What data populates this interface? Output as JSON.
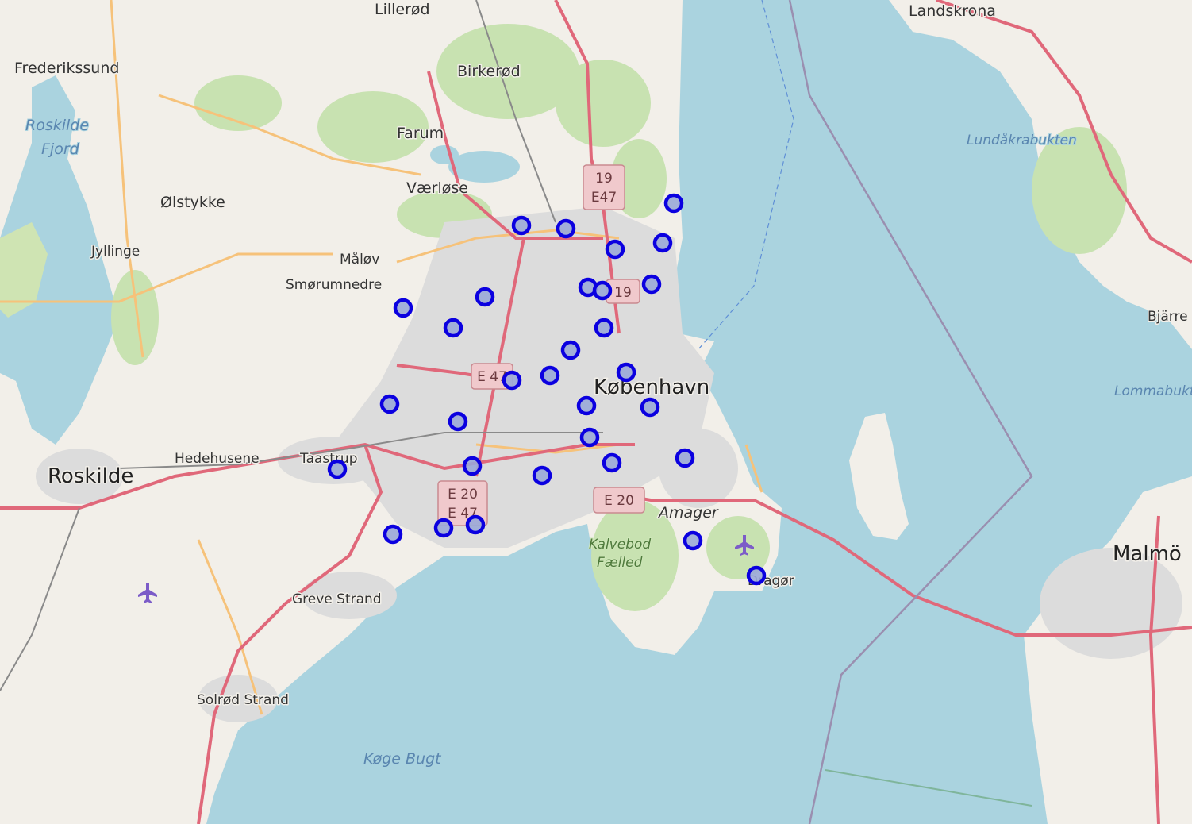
{
  "map": {
    "places": [
      {
        "id": "lillerod",
        "label": "Lillerød",
        "cls": "place-town"
      },
      {
        "id": "landskrona",
        "label": "Landskrona",
        "cls": "place-town"
      },
      {
        "id": "frederikssund",
        "label": "Frederikssund",
        "cls": "place-town"
      },
      {
        "id": "birkerod",
        "label": "Birkerød",
        "cls": "place-town"
      },
      {
        "id": "farum",
        "label": "Farum",
        "cls": "place-town"
      },
      {
        "id": "varlose",
        "label": "Værløse",
        "cls": "place-town"
      },
      {
        "id": "olstykke",
        "label": "Ølstykke",
        "cls": "place-town"
      },
      {
        "id": "jyllinge",
        "label": "Jyllinge",
        "cls": "place-village"
      },
      {
        "id": "malov",
        "label": "Måløv",
        "cls": "place-village"
      },
      {
        "id": "smorumnedre",
        "label": "Smørumnedre",
        "cls": "place-village"
      },
      {
        "id": "kobenhavn",
        "label": "København",
        "cls": "place-city"
      },
      {
        "id": "hedehusene",
        "label": "Hedehusene",
        "cls": "place-village"
      },
      {
        "id": "taastrup",
        "label": "Taastrup",
        "cls": "place-village"
      },
      {
        "id": "roskilde",
        "label": "Roskilde",
        "cls": "place-city"
      },
      {
        "id": "amager",
        "label": "Amager",
        "cls": "place-town"
      },
      {
        "id": "dragor",
        "label": "Dragør",
        "cls": "place-village"
      },
      {
        "id": "malmo",
        "label": "Malmö",
        "cls": "place-city"
      },
      {
        "id": "bjarred",
        "label": "Bjärre",
        "cls": "place-village"
      },
      {
        "id": "grevestrand",
        "label": "Greve Strand",
        "cls": "place-village"
      },
      {
        "id": "solrodstrand",
        "label": "Solrød Strand",
        "cls": "place-village"
      }
    ],
    "water_labels": [
      {
        "id": "roskildefjord1",
        "label": "Roskilde"
      },
      {
        "id": "roskildefjord2",
        "label": "Fjord"
      },
      {
        "id": "lundakrabukten",
        "label": "Lundåkrabukten"
      },
      {
        "id": "lommabukten",
        "label": "Lommabukt"
      },
      {
        "id": "kogebugt",
        "label": "Køge Bugt"
      }
    ],
    "nature_labels": [
      {
        "id": "kalvebod1",
        "label": "Kalvebod"
      },
      {
        "id": "kalvebod2",
        "label": "Fælled"
      }
    ],
    "shields": [
      {
        "id": "r19-north",
        "lines": [
          "19",
          "E47"
        ]
      },
      {
        "id": "r19-mid",
        "lines": [
          "19"
        ]
      },
      {
        "id": "e47-mid",
        "lines": [
          "E 47"
        ]
      },
      {
        "id": "e20e47",
        "lines": [
          "E 20",
          "E 47"
        ]
      },
      {
        "id": "e20-amager",
        "lines": [
          "E 20"
        ]
      }
    ],
    "markers_count": 33,
    "colors": {
      "water": "#aad3df",
      "land": "#f2efe9",
      "forest": "#c8e2b1",
      "urban": "#dcdcdc",
      "motorway": "#e0687a",
      "primary": "#f6c27a",
      "marker_stroke": "#0b00e0"
    }
  }
}
